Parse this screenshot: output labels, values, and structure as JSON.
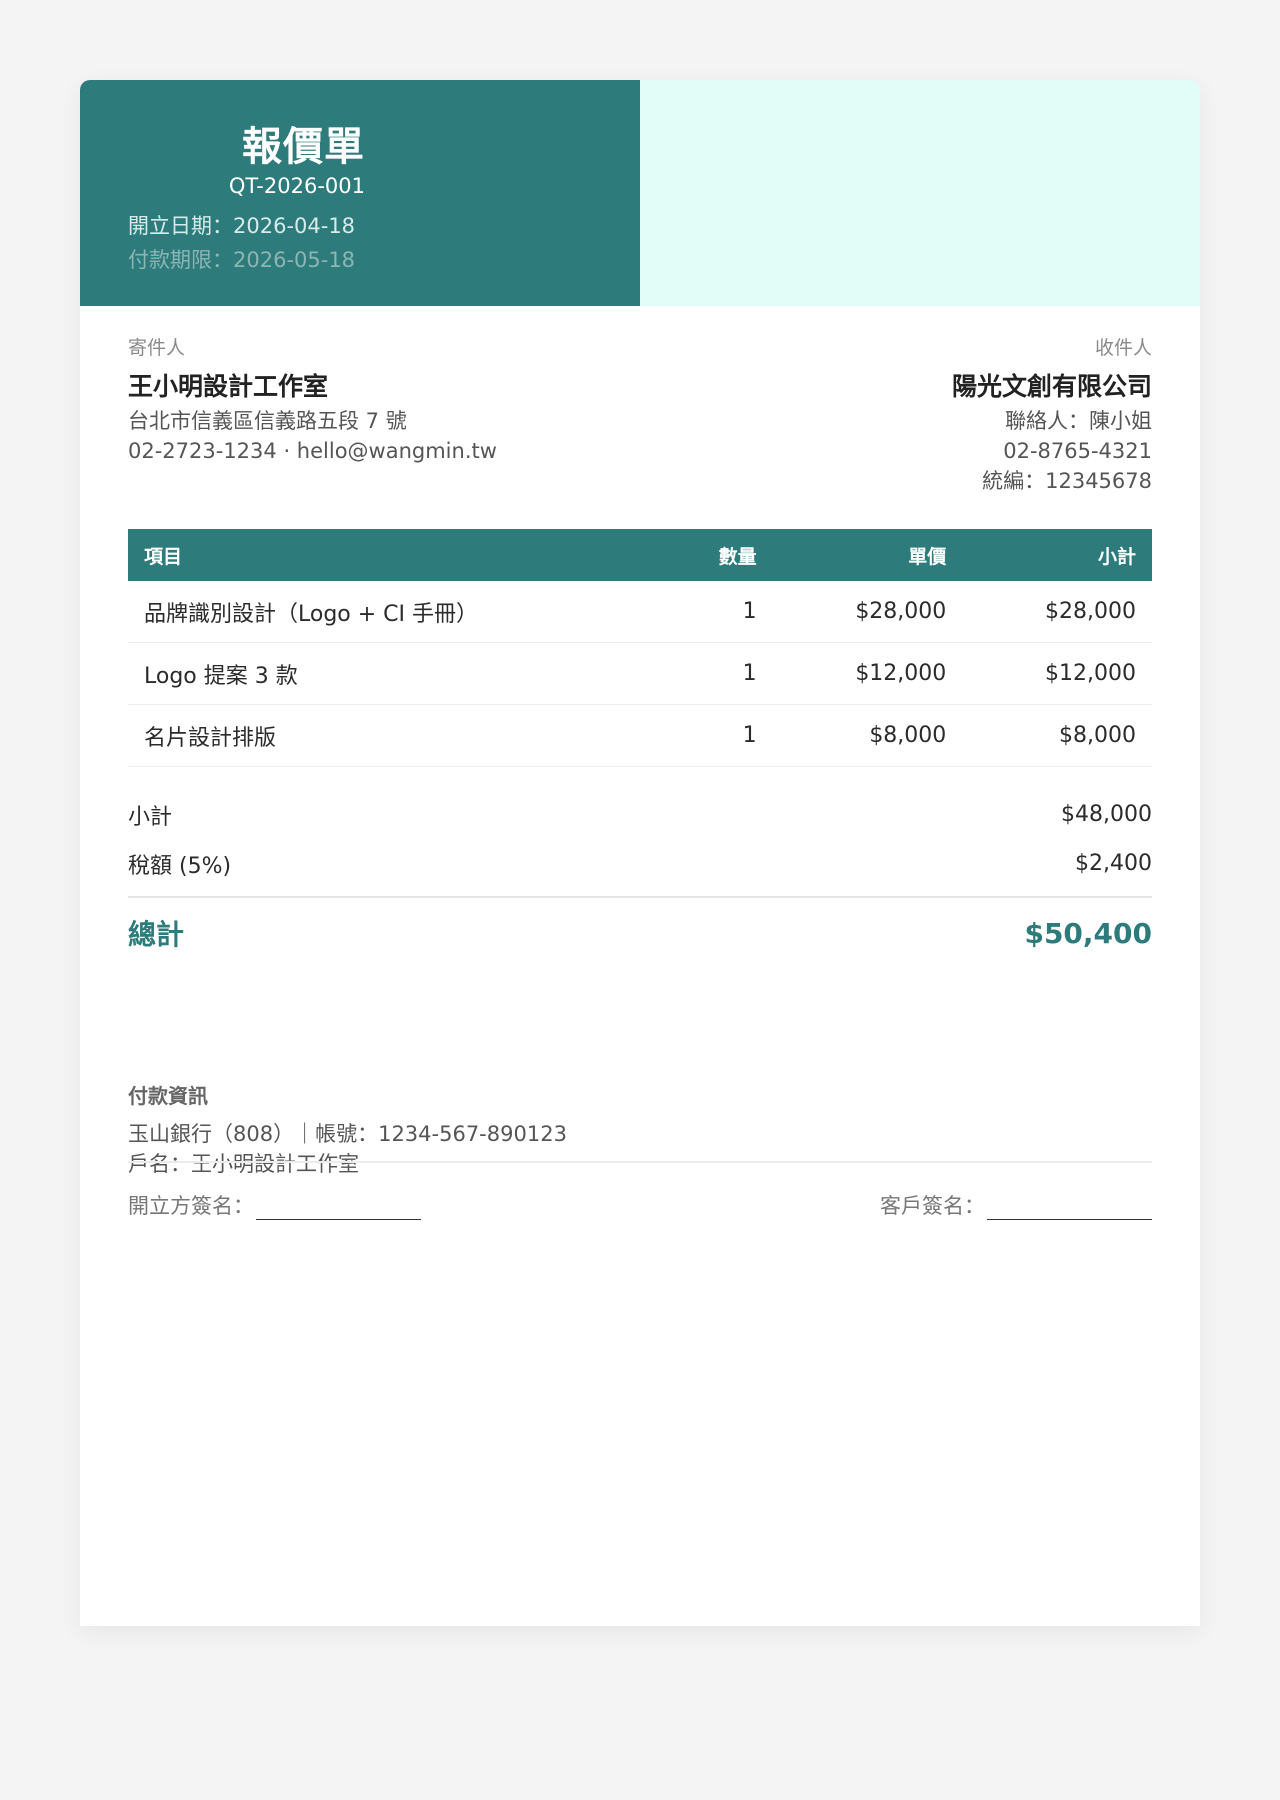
{
  "header": {
    "title": "報價單",
    "number": "QT-2026-001",
    "issue_date": "開立日期：2026-04-18",
    "due_date": "付款期限：2026-05-18"
  },
  "sender": {
    "label": "寄件人",
    "name": "王小明設計工作室",
    "address": "台北市信義區信義路五段 7 號",
    "contact": "02-2723-1234 · hello@wangmin.tw"
  },
  "recipient": {
    "label": "收件人",
    "name": "陽光文創有限公司",
    "contact_person": "聯絡人：陳小姐",
    "phone": "02-8765-4321",
    "tax_id": "統編：12345678"
  },
  "table": {
    "headers": [
      "項目",
      "數量",
      "單價",
      "小計"
    ],
    "rows": [
      {
        "item": "品牌識別設計（Logo + CI 手冊）",
        "qty": "1",
        "price": "$28,000",
        "subtotal": "$28,000"
      },
      {
        "item": "Logo 提案 3 款",
        "qty": "1",
        "price": "$12,000",
        "subtotal": "$12,000"
      },
      {
        "item": "名片設計排版",
        "qty": "1",
        "price": "$8,000",
        "subtotal": "$8,000"
      }
    ]
  },
  "summary": {
    "subtotal_label": "小計",
    "subtotal_value": "$48,000",
    "tax_label": "稅額 (5%)",
    "tax_value": "$2,400",
    "total_label": "總計",
    "total_value": "$50,400"
  },
  "payment": {
    "title": "付款資訊",
    "bank": "玉山銀行（808）｜帳號：1234-567-890123",
    "account_name": "戶名：王小明設計工作室"
  },
  "signatures": {
    "issuer_label": "開立方簽名：",
    "client_label": "客戶簽名："
  },
  "colors": {
    "accent": "#2e7b7b",
    "header_light": "#e2fdf8",
    "background": "#f4f4f4"
  }
}
